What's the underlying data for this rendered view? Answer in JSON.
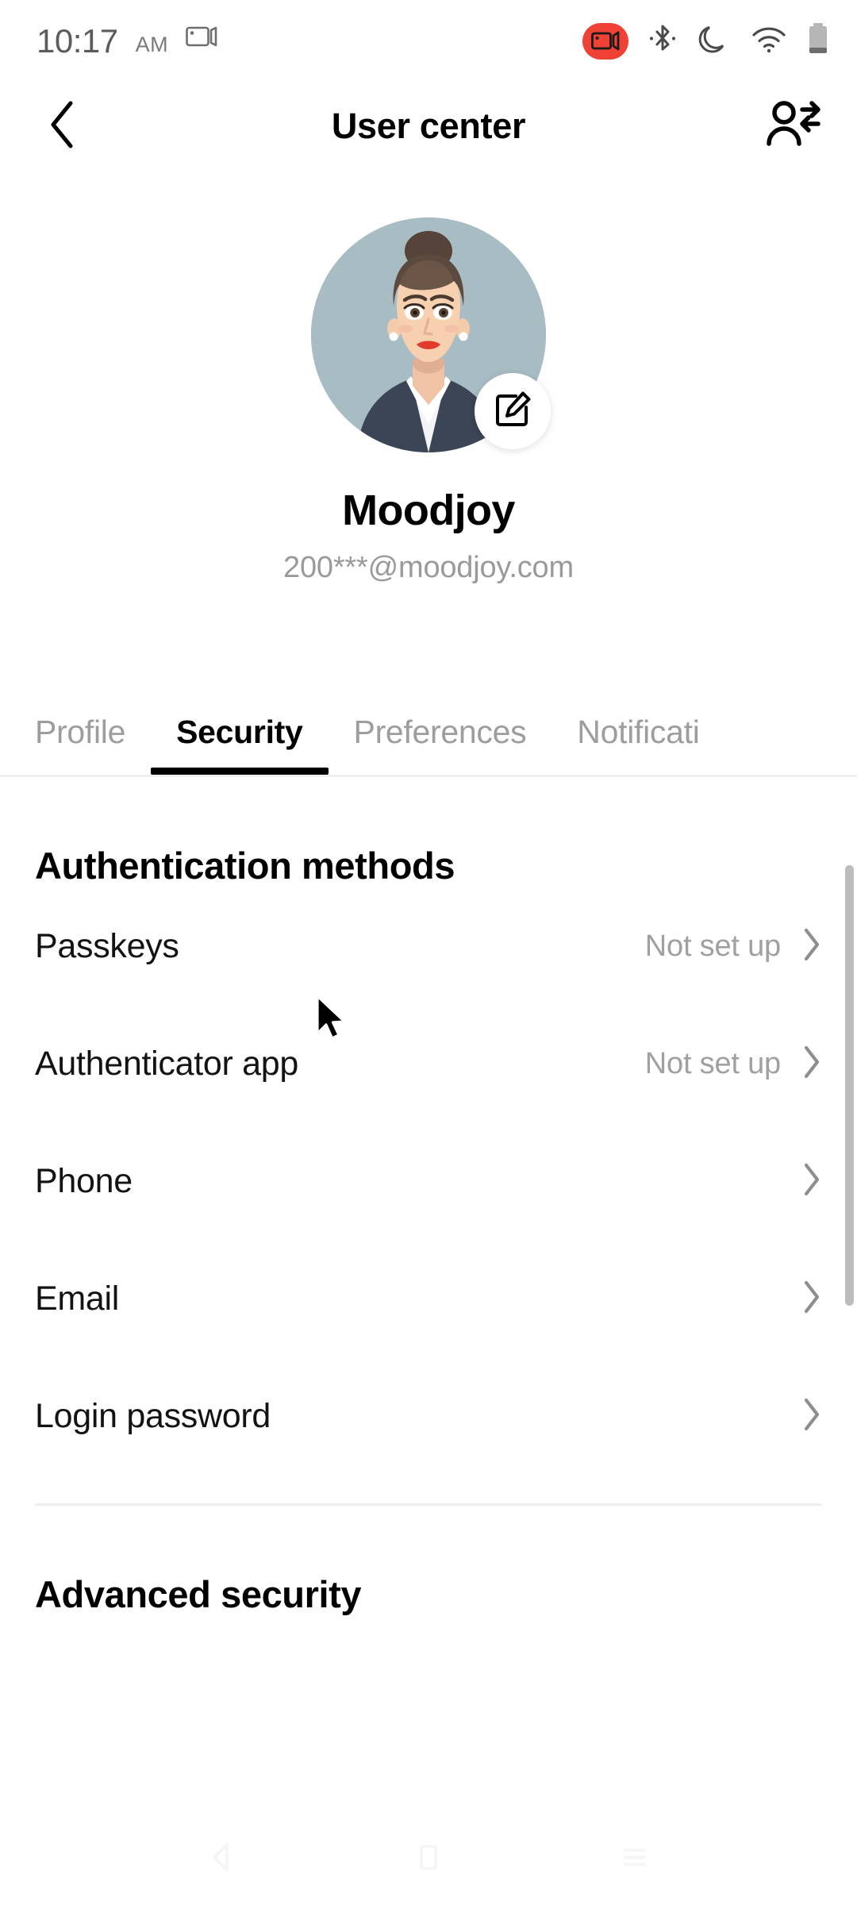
{
  "status_bar": {
    "time": "10:17",
    "ampm": "AM",
    "icons": [
      "screen-cast-icon",
      "screen-record-icon",
      "bluetooth-icon",
      "do-not-disturb-icon",
      "wifi-icon",
      "battery-icon"
    ],
    "record_badge_color": "#ef4136"
  },
  "app_bar": {
    "back_icon": "chevron-left-icon",
    "title": "User center",
    "action_icon": "switch-account-icon"
  },
  "profile": {
    "avatar_alt": "user-avatar-illustration",
    "avatar_background": "#a8bcc4",
    "edit_icon": "edit-square-pencil-icon",
    "name": "Moodjoy",
    "email": "200***@moodjoy.com"
  },
  "tabs": [
    {
      "label": "Profile",
      "active": false
    },
    {
      "label": "Security",
      "active": true
    },
    {
      "label": "Preferences",
      "active": false
    },
    {
      "label": "Notificati",
      "active": false
    }
  ],
  "sections": [
    {
      "title": "Authentication methods",
      "rows": [
        {
          "label": "Passkeys",
          "value": "Not set up",
          "chevron": "chevron-right-icon"
        },
        {
          "label": "Authenticator app",
          "value": "Not set up",
          "chevron": "chevron-right-icon"
        },
        {
          "label": "Phone",
          "value": "",
          "chevron": "chevron-right-icon"
        },
        {
          "label": "Email",
          "value": "",
          "chevron": "chevron-right-icon"
        },
        {
          "label": "Login password",
          "value": "",
          "chevron": "chevron-right-icon"
        }
      ]
    },
    {
      "title": "Advanced security",
      "rows": []
    }
  ],
  "nav_bar": {
    "back_icon": "nav-back-icon",
    "home_icon": "nav-home-icon",
    "recents_icon": "nav-recents-icon"
  }
}
